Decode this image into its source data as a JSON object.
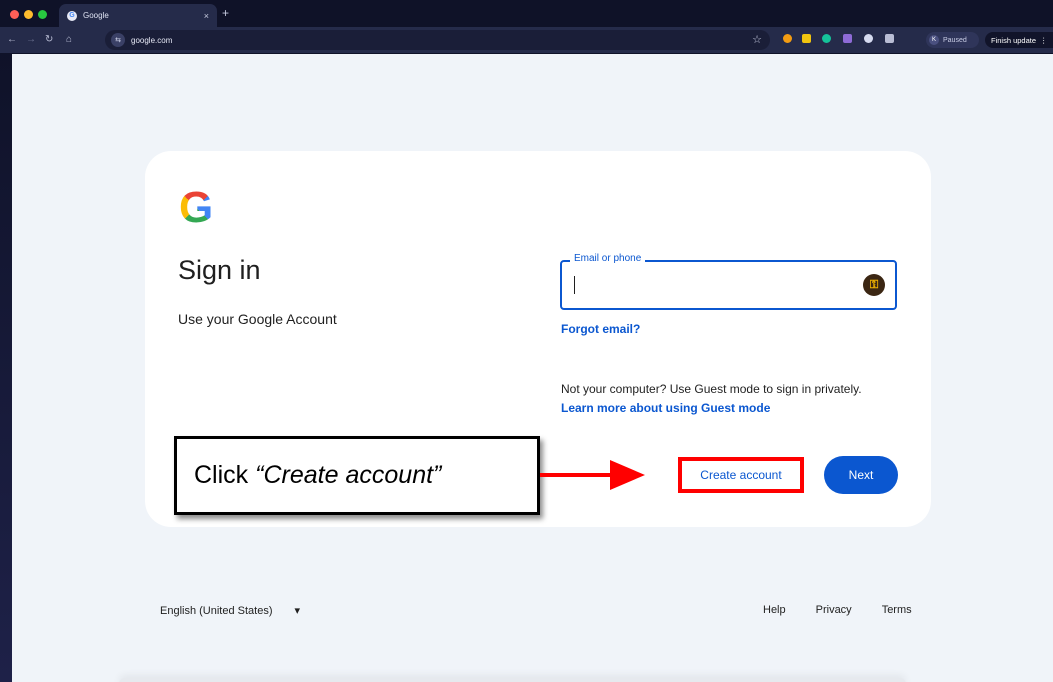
{
  "browser": {
    "tab_title": "Google",
    "new_tab_label": "+",
    "tab_close": "×",
    "url": "google.com",
    "profile_initial": "K",
    "profile_status": "Paused",
    "finish_update_label": "Finish update"
  },
  "signin": {
    "logo_letter": "G",
    "title": "Sign in",
    "subtitle": "Use your Google Account",
    "email_label": "Email or phone",
    "email_value": "",
    "forgot_email": "Forgot email?",
    "guest_text": "Not your computer? Use Guest mode to sign in privately.",
    "guest_link": "Learn more about using Guest mode",
    "create_account": "Create account",
    "next": "Next"
  },
  "footer": {
    "language": "English (United States)",
    "language_caret": "▾",
    "help": "Help",
    "privacy": "Privacy",
    "terms": "Terms"
  },
  "annotation": {
    "prefix": "Click",
    "target": "“Create account”"
  },
  "colors": {
    "accent_blue": "#0b57d0",
    "highlight_red": "#ff0000"
  }
}
